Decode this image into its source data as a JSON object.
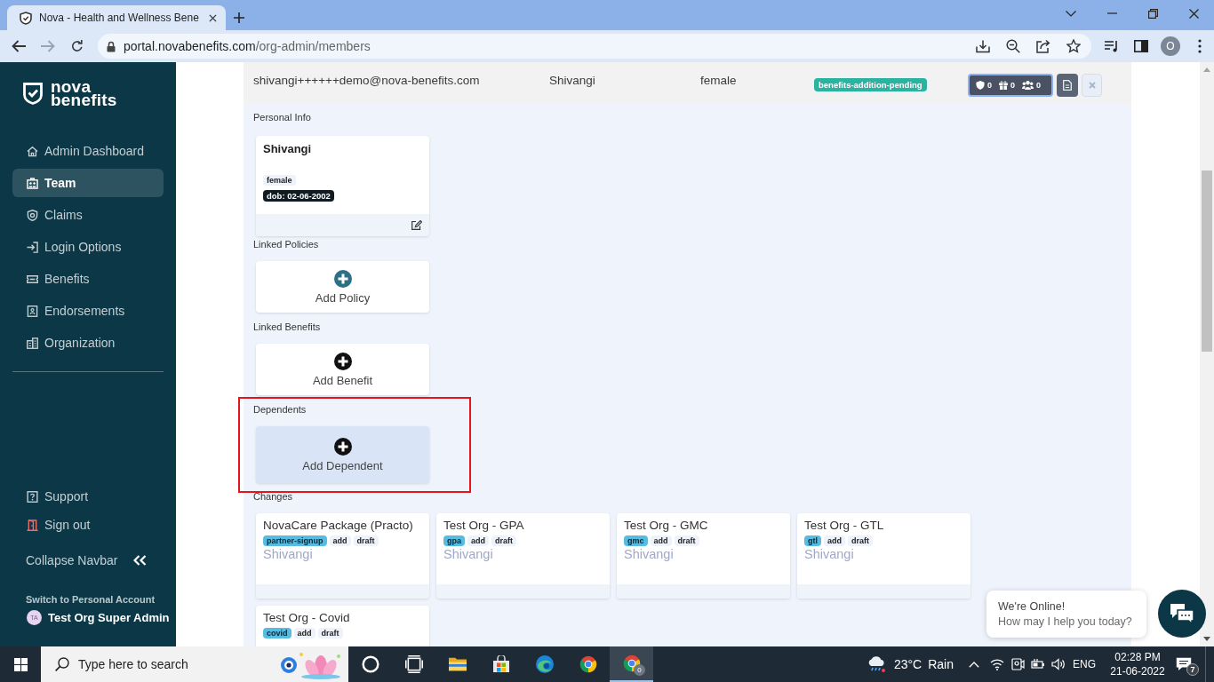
{
  "browser": {
    "tab_title": "Nova - Health and Wellness Bene",
    "url_domain": "portal.novabenefits.com",
    "url_path": "/org-admin/members",
    "profile_initial": "O"
  },
  "sidebar": {
    "logo_text": "nova benefits",
    "items": [
      {
        "label": "Admin Dashboard",
        "selected": false
      },
      {
        "label": "Team",
        "selected": true
      },
      {
        "label": "Claims",
        "selected": false
      },
      {
        "label": "Login Options",
        "selected": false
      },
      {
        "label": "Benefits",
        "selected": false
      },
      {
        "label": "Endorsements",
        "selected": false
      },
      {
        "label": "Organization",
        "selected": false
      }
    ],
    "footer_items": [
      {
        "label": "Support"
      },
      {
        "label": "Sign out"
      }
    ],
    "collapse_label": "Collapse Navbar",
    "account": {
      "caption": "Switch to Personal Account",
      "initials": "TA",
      "name": "Test Org Super Admin"
    }
  },
  "member": {
    "email": "shivangi++++++demo@nova-benefits.com",
    "name": "Shivangi",
    "gender": "female",
    "status": "benefits-addition-pending",
    "counts": [
      "0",
      "0",
      "0"
    ]
  },
  "personal_info": {
    "label": "Personal Info",
    "name": "Shivangi",
    "gender": "female",
    "dob": "dob: 02-06-2002"
  },
  "add_sections": [
    {
      "label": "Linked Policies",
      "action": "Add Policy",
      "color": "#2d6f84",
      "hovered": false,
      "highlighted": false
    },
    {
      "label": "Linked Benefits",
      "action": "Add Benefit",
      "color": "#111111",
      "hovered": false,
      "highlighted": false
    },
    {
      "label": "Dependents",
      "action": "Add Dependent",
      "color": "#111111",
      "hovered": true,
      "highlighted": true
    }
  ],
  "changes": {
    "label": "Changes",
    "cards": [
      {
        "title": "NovaCare Package (Practo)",
        "tags": [
          {
            "text": "partner-signup",
            "kind": "type"
          },
          {
            "text": "add",
            "kind": "plain"
          },
          {
            "text": "draft",
            "kind": "plain"
          }
        ],
        "person": "Shivangi"
      },
      {
        "title": "Test Org - GPA",
        "tags": [
          {
            "text": "gpa",
            "kind": "type"
          },
          {
            "text": "add",
            "kind": "plain"
          },
          {
            "text": "draft",
            "kind": "plain"
          }
        ],
        "person": "Shivangi"
      },
      {
        "title": "Test Org - GMC",
        "tags": [
          {
            "text": "gmc",
            "kind": "type"
          },
          {
            "text": "add",
            "kind": "plain"
          },
          {
            "text": "draft",
            "kind": "plain"
          }
        ],
        "person": "Shivangi"
      },
      {
        "title": "Test Org - GTL",
        "tags": [
          {
            "text": "gtl",
            "kind": "type"
          },
          {
            "text": "add",
            "kind": "plain"
          },
          {
            "text": "draft",
            "kind": "plain"
          }
        ],
        "person": "Shivangi"
      },
      {
        "title": "Test Org - Covid",
        "tags": [
          {
            "text": "covid",
            "kind": "type"
          },
          {
            "text": "add",
            "kind": "plain"
          },
          {
            "text": "draft",
            "kind": "plain"
          }
        ]
      }
    ]
  },
  "chat": {
    "title": "We're Online!",
    "message": "How may I help you today?"
  },
  "taskbar": {
    "search": {
      "placeholder": "Type here to search"
    },
    "apps": [
      {
        "selected": false
      },
      {
        "selected": false
      },
      {
        "selected": false
      },
      {
        "selected": false
      },
      {
        "selected": false
      },
      {
        "selected": false
      },
      {
        "selected": true,
        "badge": "0"
      }
    ],
    "temperature": "23°C",
    "weather": "Rain",
    "language": "ENG",
    "time": "02:28 PM",
    "date": "21-06-2022",
    "notifications": "7"
  }
}
